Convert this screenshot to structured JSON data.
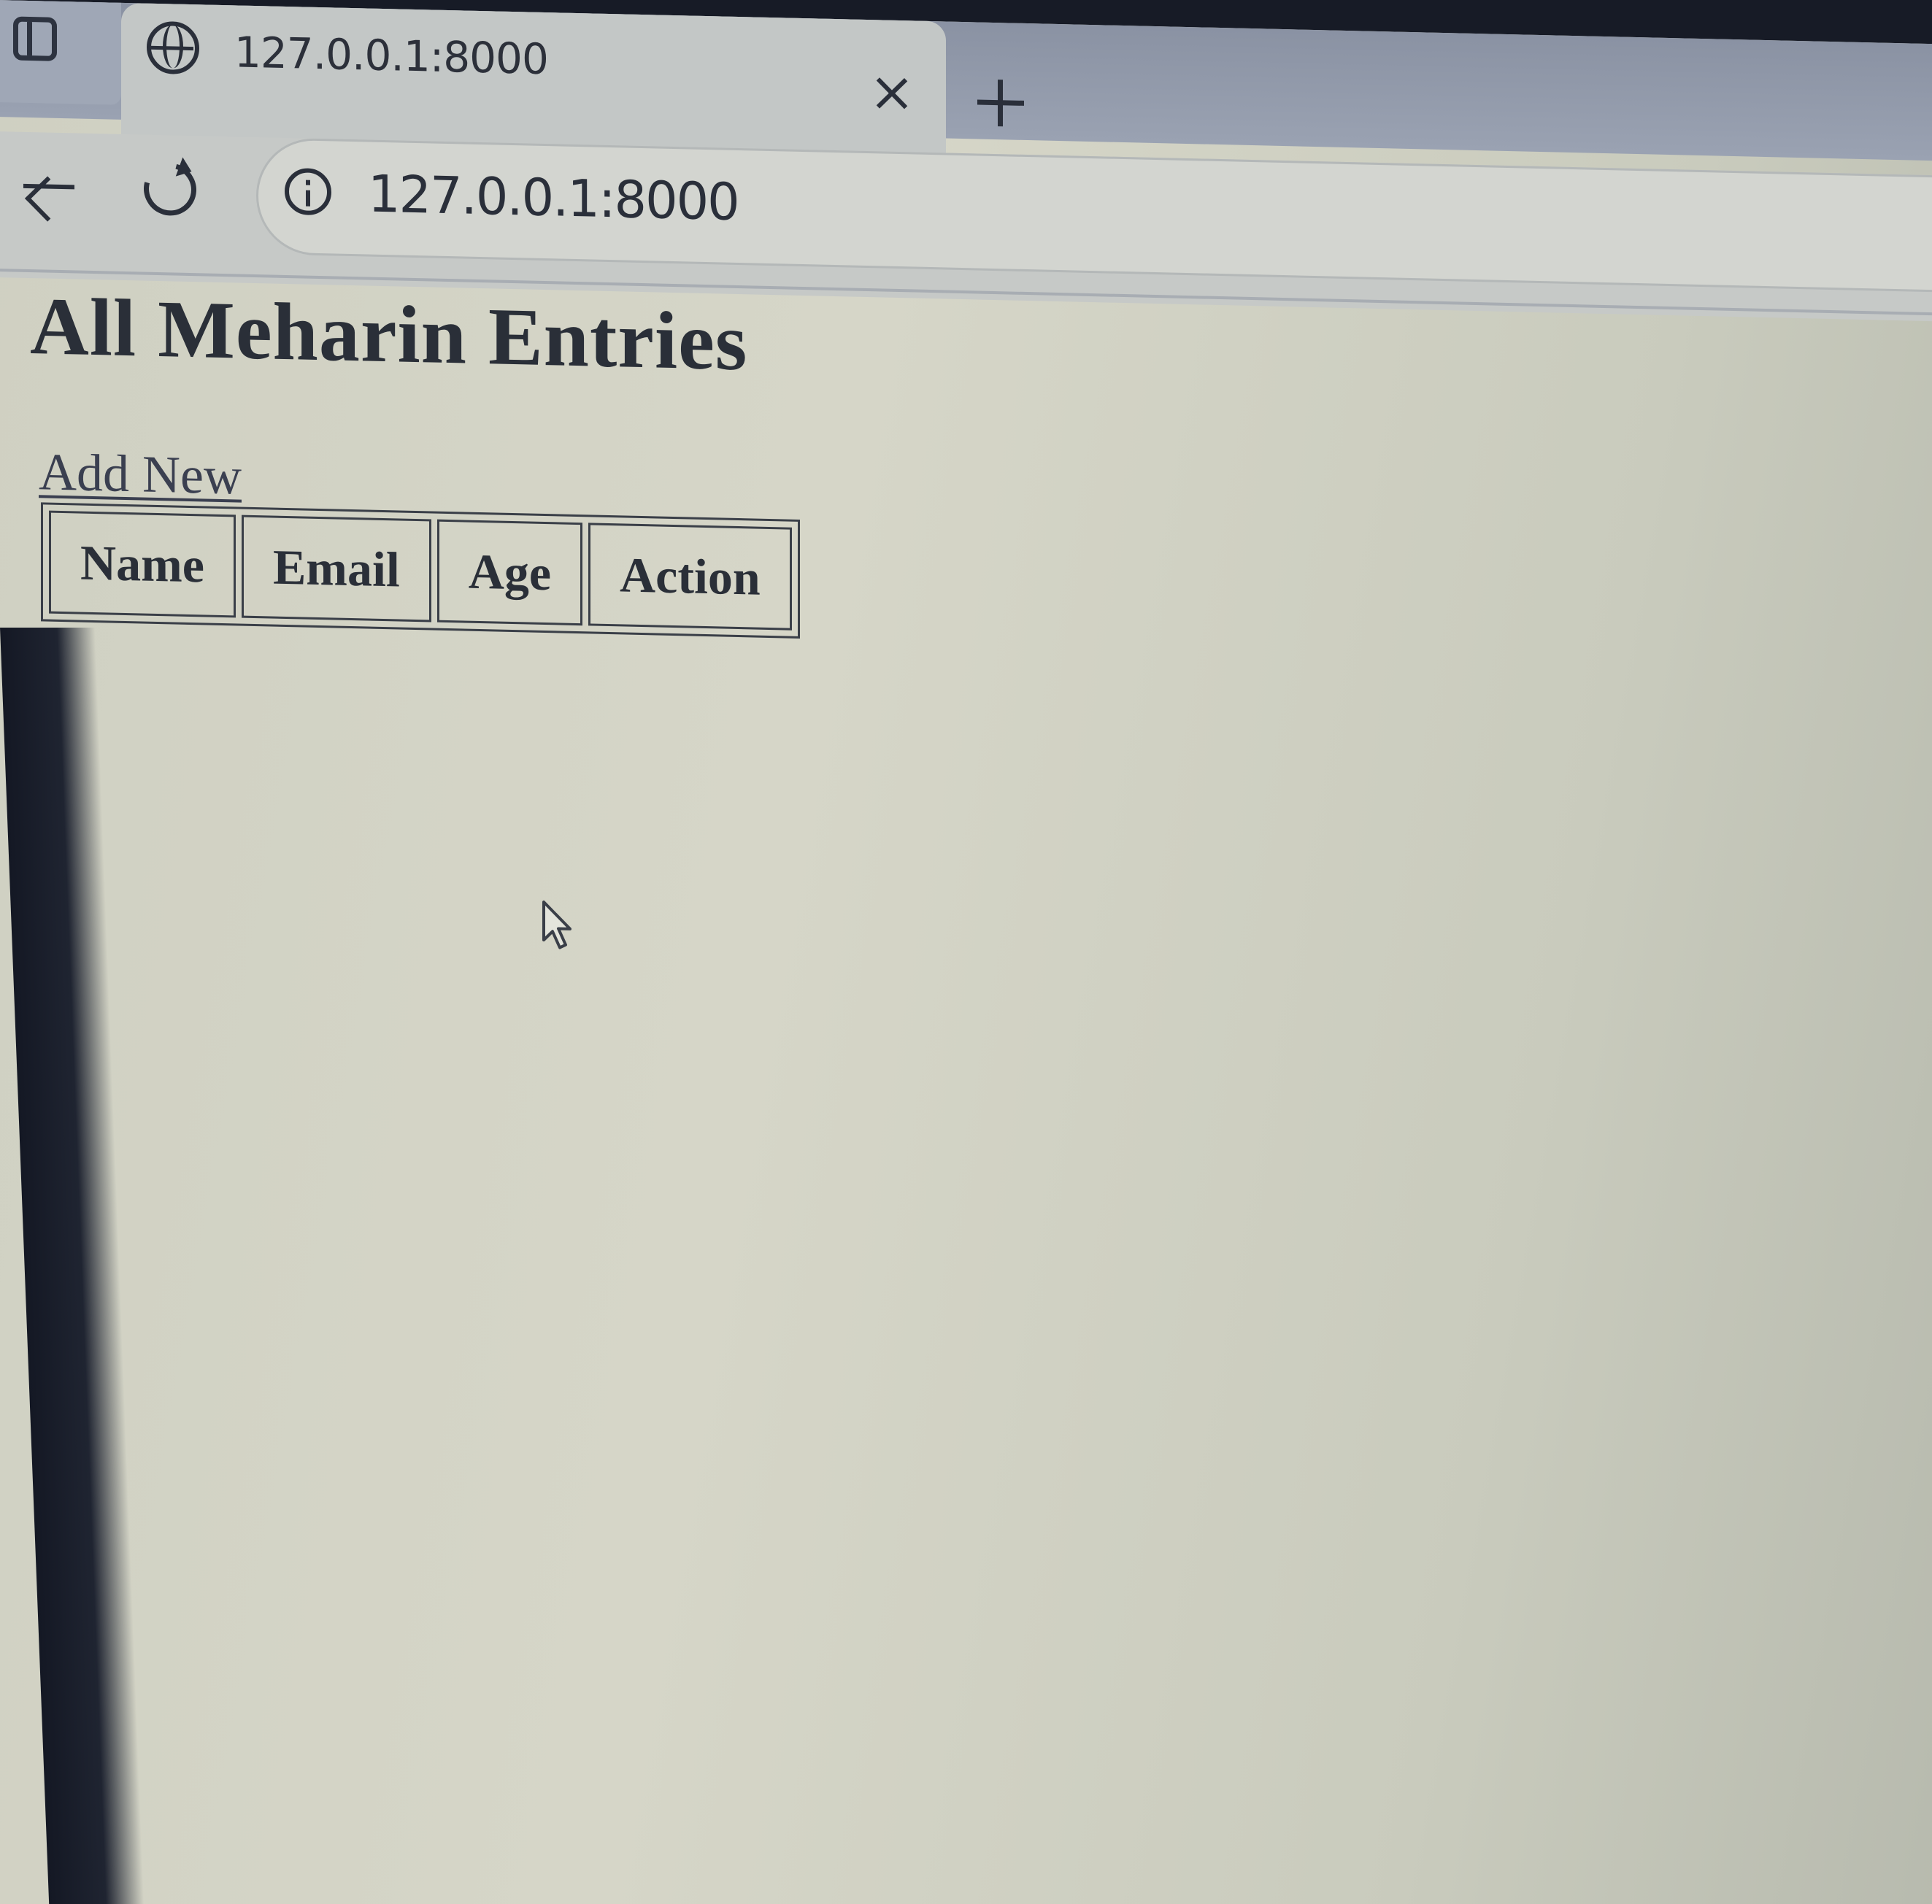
{
  "browser": {
    "tab": {
      "title": "127.0.0.1:8000"
    },
    "address_bar": {
      "url": "127.0.0.1:8000"
    },
    "icons": [
      "sidebar-toggle-icon",
      "globe-icon",
      "close-icon",
      "plus-icon",
      "back-arrow-icon",
      "reload-icon",
      "info-icon",
      "mouse-pointer-icon"
    ]
  },
  "page": {
    "title": "All Meharin Entries",
    "add_link": "Add New",
    "table": {
      "headers": [
        "Name",
        "Email",
        "Age",
        "Action"
      ],
      "rows": []
    }
  },
  "colors": {
    "page_background": "#d6d6c8",
    "text": "#2a2f38",
    "tab_strip": "#8a92a3"
  }
}
